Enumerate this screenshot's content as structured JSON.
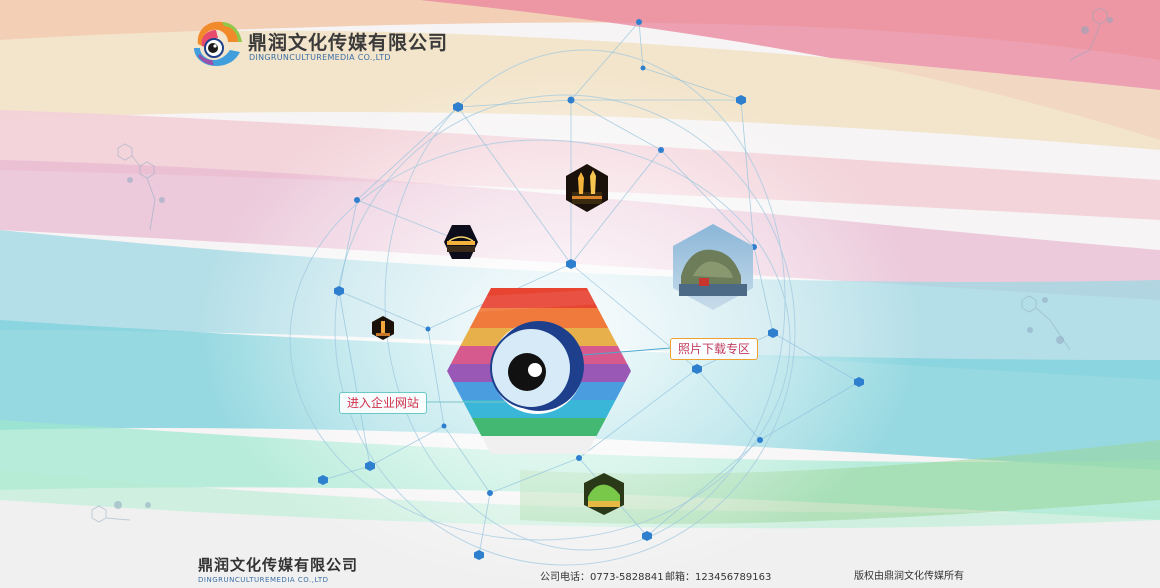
{
  "brand": {
    "name_cn": "鼎润文化传媒有限公司",
    "name_en": "DINGRUNCULTUREMEDIA CO.,LTD"
  },
  "links": {
    "enter_site": "进入企业网站",
    "photo_download": "照片下载专区"
  },
  "footer": {
    "name_cn": "鼎润文化传媒有限公司",
    "name_en": "DINGRUNCULTUREMEDIA CO.,LTD",
    "phone_label": "公司电话：",
    "phone": "0773-5828841",
    "email_label": "邮箱：",
    "email": "123456789163",
    "copyright": "版权由鼎润文化传媒所有"
  },
  "colors": {
    "accent_blue": "#3a8fd8",
    "node_blue": "#2f7fcf",
    "link_text_red": "#d0304b",
    "logo_navy": "#1d3f8c"
  },
  "icons": [
    "camera-eye-logo-icon",
    "hexagon-photo-icon"
  ]
}
